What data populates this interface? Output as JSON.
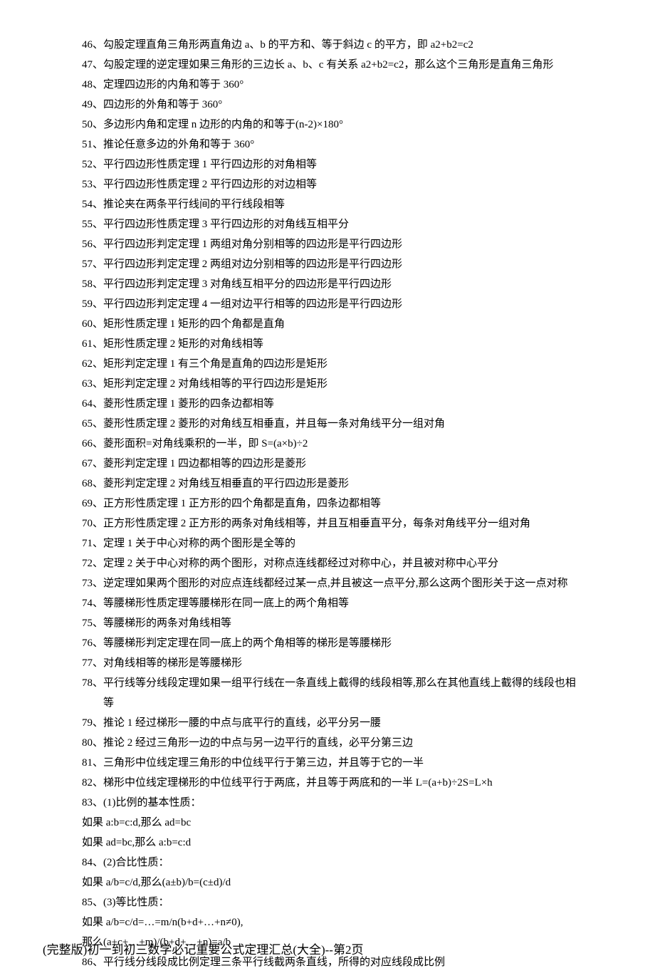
{
  "items": [
    {
      "num": "46、",
      "text": "勾股定理直角三角形两直角边 a、b 的平方和、等于斜边 c 的平方，即 a2+b2=c2"
    },
    {
      "num": "47、",
      "text": "勾股定理的逆定理如果三角形的三边长 a、b、c 有关系 a2+b2=c2，那么这个三角形是直角三角形"
    },
    {
      "num": "48、",
      "text": "定理四边形的内角和等于 360°"
    },
    {
      "num": "49、",
      "text": "四边形的外角和等于 360°"
    },
    {
      "num": "50、",
      "text": "多边形内角和定理 n 边形的内角的和等于(n-2)×180°"
    },
    {
      "num": "51、",
      "text": "推论任意多边的外角和等于 360°"
    },
    {
      "num": "52、",
      "text": "平行四边形性质定理 1 平行四边形的对角相等"
    },
    {
      "num": "53、",
      "text": "平行四边形性质定理 2 平行四边形的对边相等"
    },
    {
      "num": "54、",
      "text": "推论夹在两条平行线间的平行线段相等"
    },
    {
      "num": "55、",
      "text": "平行四边形性质定理 3 平行四边形的对角线互相平分"
    },
    {
      "num": "56、",
      "text": "平行四边形判定定理 1 两组对角分别相等的四边形是平行四边形"
    },
    {
      "num": "57、",
      "text": "平行四边形判定定理 2 两组对边分别相等的四边形是平行四边形"
    },
    {
      "num": "58、",
      "text": "平行四边形判定定理 3 对角线互相平分的四边形是平行四边形"
    },
    {
      "num": "59、",
      "text": "平行四边形判定定理 4 一组对边平行相等的四边形是平行四边形"
    },
    {
      "num": "60、",
      "text": "矩形性质定理 1 矩形的四个角都是直角"
    },
    {
      "num": "61、",
      "text": "矩形性质定理 2 矩形的对角线相等"
    },
    {
      "num": "62、",
      "text": "矩形判定定理 1 有三个角是直角的四边形是矩形"
    },
    {
      "num": "63、",
      "text": "矩形判定定理 2 对角线相等的平行四边形是矩形"
    },
    {
      "num": "64、",
      "text": "菱形性质定理 1 菱形的四条边都相等"
    },
    {
      "num": "65、",
      "text": "菱形性质定理 2 菱形的对角线互相垂直，并且每一条对角线平分一组对角"
    },
    {
      "num": "66、",
      "text": "菱形面积=对角线乘积的一半，即 S=(a×b)÷2"
    },
    {
      "num": "67、",
      "text": "菱形判定定理 1 四边都相等的四边形是菱形"
    },
    {
      "num": "68、",
      "text": "菱形判定定理 2 对角线互相垂直的平行四边形是菱形"
    },
    {
      "num": "69、",
      "text": "正方形性质定理 1 正方形的四个角都是直角，四条边都相等"
    },
    {
      "num": "70、",
      "text": "正方形性质定理 2 正方形的两条对角线相等，并且互相垂直平分，每条对角线平分一组对角"
    },
    {
      "num": "71、",
      "text": "定理 1 关于中心对称的两个图形是全等的"
    },
    {
      "num": "72、",
      "text": "定理 2 关于中心对称的两个图形，对称点连线都经过对称中心，并且被对称中心平分"
    },
    {
      "num": "73、",
      "text": "逆定理如果两个图形的对应点连线都经过某一点,并且被这一点平分,那么这两个图形关于这一点对称"
    },
    {
      "num": "74、",
      "text": "等腰梯形性质定理等腰梯形在同一底上的两个角相等"
    },
    {
      "num": "75、",
      "text": "等腰梯形的两条对角线相等"
    },
    {
      "num": "76、",
      "text": "等腰梯形判定定理在同一底上的两个角相等的梯形是等腰梯形"
    },
    {
      "num": "77、",
      "text": "对角线相等的梯形是等腰梯形"
    },
    {
      "num": "78、",
      "text": "平行线等分线段定理如果一组平行线在一条直线上截得的线段相等,那么在其他直线上截得的线段也相",
      "cont": "等"
    },
    {
      "num": "79、",
      "text": "推论 1 经过梯形一腰的中点与底平行的直线，必平分另一腰"
    },
    {
      "num": "80、",
      "text": "推论 2 经过三角形一边的中点与另一边平行的直线，必平分第三边"
    },
    {
      "num": "81、",
      "text": "三角形中位线定理三角形的中位线平行于第三边，并且等于它的一半"
    },
    {
      "num": "82、",
      "text": "梯形中位线定理梯形的中位线平行于两底，并且等于两底和的一半 L=(a+b)÷2S=L×h"
    },
    {
      "num": "83、",
      "text": "(1)比例的基本性质："
    },
    {
      "num": "",
      "text": "如果 a:b=c:d,那么 ad=bc",
      "plain": true
    },
    {
      "num": "",
      "text": "如果 ad=bc,那么 a:b=c:d",
      "plain": true
    },
    {
      "num": "84、",
      "text": "(2)合比性质："
    },
    {
      "num": "",
      "text": "如果 a/b=c/d,那么(a±b)/b=(c±d)/d",
      "plain": true
    },
    {
      "num": "85、",
      "text": "(3)等比性质："
    },
    {
      "num": "",
      "text": "如果 a/b=c/d=…=m/n(b+d+…+n≠0),",
      "plain": true
    },
    {
      "num": "",
      "text": "那么(a+c+…+m)/(b+d+…+n)=a/b",
      "plain": true
    },
    {
      "num": "86、",
      "text": "平行线分线段成比例定理三条平行线截两条直线，所得的对应线段成比例"
    }
  ],
  "footer": "(完整版)初一到初三数学必记重要公式定理汇总(大全)--第2页"
}
